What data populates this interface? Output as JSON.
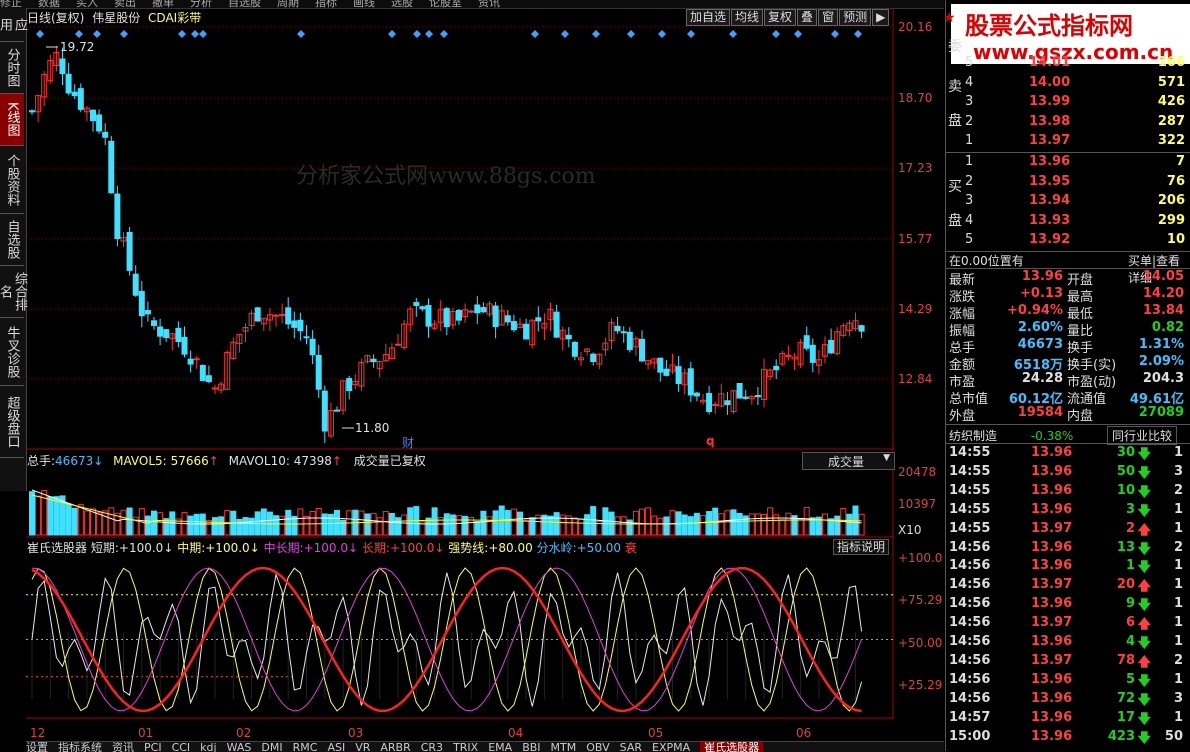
{
  "top_menu": [
    "修正",
    "数据",
    "买入",
    "卖出",
    "撤单",
    "分析",
    "自选股",
    "周期",
    "指标",
    "画线",
    "选股",
    "论股室",
    "资讯"
  ],
  "left_tabs": [
    "应用",
    "分时图",
    "K线图",
    "个股资料",
    "自选股",
    "综合排名",
    "牛叉诊股",
    "超级盘口"
  ],
  "left_tab_active": 2,
  "chart_header": {
    "period": "日线(复权)",
    "stock_name": "伟星股份",
    "indicator": "CDAI彩带"
  },
  "toolbar": [
    "加自选",
    "均线",
    "复权",
    "叠",
    "窗",
    "预测",
    "▶"
  ],
  "price_axis": [
    "20.16",
    "18.70",
    "17.23",
    "15.77",
    "14.29",
    "12.84"
  ],
  "watermark": "分析家公式网www.88gs.com",
  "annotations": {
    "high": "19.72",
    "low": "11.80",
    "marker_cai": "财",
    "marker_q": "q"
  },
  "volume_header": {
    "total_label": "总手:",
    "total_value": "46673",
    "ma5_label": "MAVOL5:",
    "ma5_value": "57666",
    "ma10_label": "MAVOL10:",
    "ma10_value": "47398",
    "note": "成交量已复权"
  },
  "volume_selector": "成交量",
  "volume_axis": [
    "20478",
    "10397",
    "X10"
  ],
  "indicator_header": {
    "name": "崔氏选股器",
    "short_label": "短期:",
    "short_value": "+100.0",
    "mid_label": "中期:",
    "mid_value": "+100.0",
    "midlong_label": "中长期:",
    "midlong_value": "+100.0",
    "long_label": "长期:",
    "long_value": "+100.0",
    "strong_label": "强势线:",
    "strong_value": "+80.00",
    "water_label": "分水岭:",
    "water_value": "+50.00",
    "tail": "衰"
  },
  "indicator_button": "指标说明",
  "indicator_axis": [
    "+100.0",
    "+75.29",
    "+50.00",
    "+25.29"
  ],
  "x_axis": [
    "12",
    "01",
    "02",
    "03",
    "04",
    "05",
    "06"
  ],
  "bottom_tabs": [
    "设置",
    "指标系统",
    "资讯",
    "PCI",
    "CCI",
    "kdj",
    "WAS",
    "DMI",
    "RMC",
    "ASI",
    "VR",
    "ARBR",
    "CR3",
    "TRIX",
    "EMA",
    "BBI",
    "MTM",
    "OBV",
    "SAR",
    "EXPMA",
    "崔氏选股器"
  ],
  "bottom_tab_active": 20,
  "logo": {
    "line1": "股票公式指标网",
    "line2": "www.gszx.com.cn"
  },
  "orderbook": {
    "wei_label": "委",
    "sell_label_1": "卖",
    "sell_label_2": "盘",
    "buy_label_1": "买",
    "buy_label_2": "盘",
    "sells": [
      {
        "level": "5",
        "price": "14.01",
        "vol": "166"
      },
      {
        "level": "4",
        "price": "14.00",
        "vol": "571"
      },
      {
        "level": "3",
        "price": "13.99",
        "vol": "426"
      },
      {
        "level": "2",
        "price": "13.98",
        "vol": "287"
      },
      {
        "level": "1",
        "price": "13.97",
        "vol": "322"
      }
    ],
    "buys": [
      {
        "level": "1",
        "price": "13.96",
        "vol": "7"
      },
      {
        "level": "2",
        "price": "13.95",
        "vol": "76"
      },
      {
        "level": "3",
        "price": "13.94",
        "vol": "206"
      },
      {
        "level": "4",
        "price": "13.93",
        "vol": "299"
      },
      {
        "level": "5",
        "price": "13.92",
        "vol": "10"
      }
    ],
    "position_text": "在0.00位置有",
    "detail_text": "买单|查看详细"
  },
  "quote": [
    {
      "l1": "最新",
      "v1": "13.96",
      "c1": "red",
      "l2": "开盘",
      "v2": "14.05",
      "c2": "red"
    },
    {
      "l1": "涨跌",
      "v1": "+0.13",
      "c1": "red",
      "l2": "最高",
      "v2": "14.20",
      "c2": "red"
    },
    {
      "l1": "涨幅",
      "v1": "+0.94%",
      "c1": "red",
      "l2": "最低",
      "v2": "13.84",
      "c2": "red"
    },
    {
      "l1": "振幅",
      "v1": "2.60%",
      "c1": "cyan",
      "l2": "量比",
      "v2": "0.82",
      "c2": "green"
    },
    {
      "l1": "总手",
      "v1": "46673",
      "c1": "cyan",
      "l2": "换手",
      "v2": "1.31%",
      "c2": "cyan"
    },
    {
      "l1": "金额",
      "v1": "6518万",
      "c1": "cyan",
      "l2": "换手(实)",
      "v2": "2.09%",
      "c2": "cyan"
    },
    {
      "l1": "市盈",
      "v1": "24.28",
      "c1": "white",
      "l2": "市盈(动)",
      "v2": "204.3",
      "c2": "white"
    },
    {
      "l1": "总市值",
      "v1": "60.12亿",
      "c1": "cyan",
      "l2": "流通值",
      "v2": "49.61亿",
      "c2": "cyan"
    },
    {
      "l1": "外盘",
      "v1": "19584",
      "c1": "red",
      "l2": "内盘",
      "v2": "27089",
      "c2": "green"
    }
  ],
  "industry": {
    "name": "纺织制造",
    "change": "-0.38%",
    "compare": "同行业比较"
  },
  "ticks": [
    {
      "t": "14:55",
      "p": "13.96",
      "v": "30",
      "d": "down",
      "n": "1"
    },
    {
      "t": "14:55",
      "p": "13.96",
      "v": "50",
      "d": "down",
      "n": "3"
    },
    {
      "t": "14:55",
      "p": "13.96",
      "v": "10",
      "d": "down",
      "n": "2"
    },
    {
      "t": "14:55",
      "p": "13.96",
      "v": "3",
      "d": "down",
      "n": "1"
    },
    {
      "t": "14:55",
      "p": "13.97",
      "v": "2",
      "d": "up",
      "n": "1"
    },
    {
      "t": "14:56",
      "p": "13.96",
      "v": "13",
      "d": "down",
      "n": "2"
    },
    {
      "t": "14:56",
      "p": "13.96",
      "v": "1",
      "d": "down",
      "n": "1"
    },
    {
      "t": "14:56",
      "p": "13.97",
      "v": "20",
      "d": "up",
      "n": "1"
    },
    {
      "t": "14:56",
      "p": "13.96",
      "v": "9",
      "d": "down",
      "n": "1"
    },
    {
      "t": "14:56",
      "p": "13.97",
      "v": "6",
      "d": "up",
      "n": "1"
    },
    {
      "t": "14:56",
      "p": "13.96",
      "v": "4",
      "d": "down",
      "n": "1"
    },
    {
      "t": "14:56",
      "p": "13.97",
      "v": "78",
      "d": "up",
      "n": "2"
    },
    {
      "t": "14:56",
      "p": "13.96",
      "v": "5",
      "d": "down",
      "n": "1"
    },
    {
      "t": "14:56",
      "p": "13.96",
      "v": "72",
      "d": "down",
      "n": "3"
    },
    {
      "t": "14:57",
      "p": "13.96",
      "v": "17",
      "d": "down",
      "n": "1"
    },
    {
      "t": "15:00",
      "p": "13.96",
      "v": "423",
      "d": "down",
      "n": "50"
    }
  ],
  "colors": {
    "up": "#ff3030",
    "down": "#40e0ff",
    "ma5": "#ffffff",
    "ma10": "#ffff00",
    "grid": "#800000"
  }
}
